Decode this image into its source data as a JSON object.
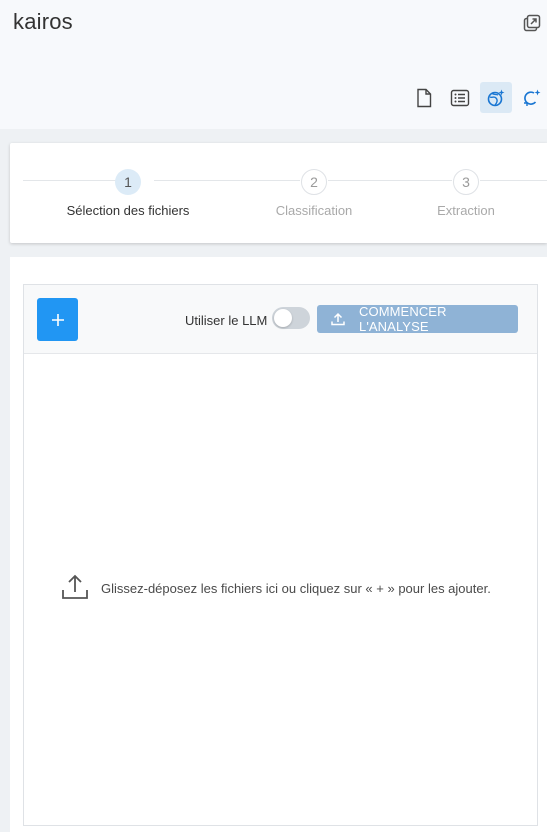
{
  "app": {
    "title": "kairos"
  },
  "header": {
    "icons": {
      "external": "open-in-new-icon",
      "toolbar": [
        "document-icon",
        "list-icon",
        "globe-sparkle-icon",
        "refresh-sparkle-icon"
      ],
      "active_index": 2
    }
  },
  "stepper": {
    "steps": [
      {
        "number": "1",
        "label": "Sélection des fichiers",
        "state": "active"
      },
      {
        "number": "2",
        "label": "Classification",
        "state": "inactive"
      },
      {
        "number": "3",
        "label": "Extraction",
        "state": "inactive"
      }
    ]
  },
  "upload": {
    "add_label": "+",
    "llm_label": "Utiliser le LLM",
    "llm_enabled": false,
    "analyze_label": "COMMENCER L'ANALYSE",
    "drop_text": "Glissez-déposez les fichiers ici ou cliquez sur « + » pour les ajouter."
  },
  "colors": {
    "accent": "#2196f3",
    "analyze_disabled": "#8fb3d6",
    "active_step": "#dcebf7",
    "icon_blue": "#1976d2"
  }
}
